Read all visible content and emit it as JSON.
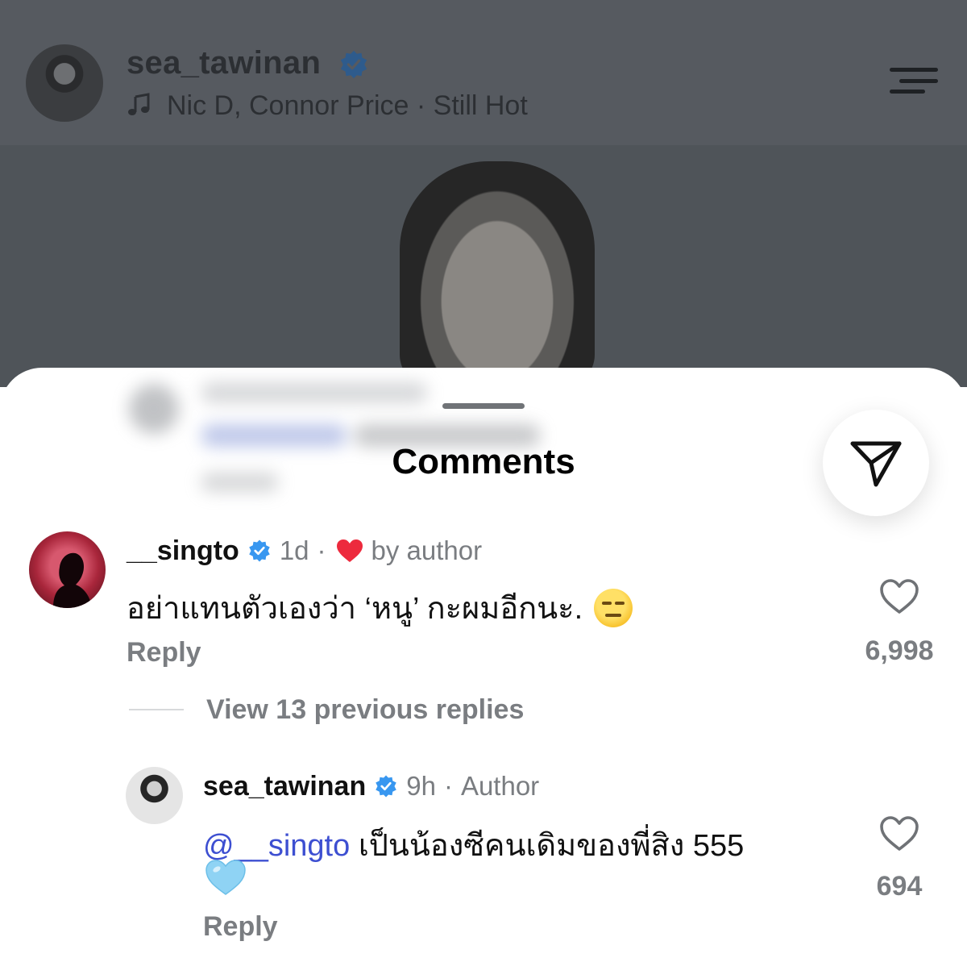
{
  "post": {
    "username": "sea_tawinan",
    "music": "Nic D, Connor Price · Still Hot"
  },
  "sheet": {
    "title": "Comments"
  },
  "comments": [
    {
      "username": "__singto",
      "time": "1d",
      "separator": "·",
      "liked_label": "by author",
      "text": "อย่าแทนตัวเองว่า ‘หนู’ กะผมอีกนะ.",
      "emoji": "expressionless-face",
      "reply_label": "Reply",
      "likes": "6,998"
    }
  ],
  "view_replies_label": "View 13 previous replies",
  "reply": {
    "username": "sea_tawinan",
    "time": "9h",
    "separator": "·",
    "author_label": "Author",
    "mention": "@__singto",
    "text": "เป็นน้องซีคนเดิมของพี่สิง 555",
    "emoji": "light-blue-heart",
    "reply_label": "Reply",
    "likes": "694"
  },
  "colors": {
    "verified": "#3897f0",
    "mention": "#3d4fd1",
    "heart_red": "#ed2a3d",
    "heart_light_blue": "#8fd3f4",
    "secondary_text": "#7a7d81"
  }
}
